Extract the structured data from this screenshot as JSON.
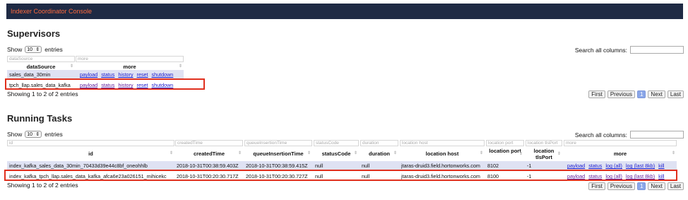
{
  "app": {
    "title": "Indexer Coordinator Console"
  },
  "supervisors": {
    "heading": "Supervisors",
    "show_label": "Show",
    "entries_value": "10",
    "entries_label": "entries",
    "search_label": "Search all columns:",
    "filters": [
      "dataSource",
      "more"
    ],
    "columns": [
      "dataSource",
      "more"
    ],
    "rows": [
      {
        "dataSource": "sales_data_30min",
        "links": [
          "payload",
          "status",
          "history",
          "reset",
          "shutdown"
        ]
      },
      {
        "dataSource": "tpch_llap.sales_data_kafka",
        "links": [
          "payload",
          "status",
          "history",
          "reset",
          "shutdown"
        ]
      }
    ],
    "info": "Showing 1 to 2 of 2 entries",
    "pager": {
      "first": "First",
      "previous": "Previous",
      "page": "1",
      "next": "Next",
      "last": "Last"
    }
  },
  "tasks": {
    "heading": "Running Tasks",
    "show_label": "Show",
    "entries_value": "10",
    "entries_label": "entries",
    "search_label": "Search all columns:",
    "filters": [
      "id",
      "createdTime",
      "queueInsertionTime",
      "statusCode",
      "duration",
      "location host",
      "location port",
      "location tlsPort",
      "more"
    ],
    "columns": [
      "id",
      "createdTime",
      "queueInsertionTime",
      "statusCode",
      "duration",
      "location host",
      "location port",
      "location tlsPort",
      "more"
    ],
    "rows": [
      {
        "id": "index_kafka_sales_data_30min_70433d39e44c8bf_oneohhlb",
        "createdTime": "2018-10-31T00:38:59.403Z",
        "queueInsertionTime": "2018-10-31T00:38:59.415Z",
        "statusCode": "null",
        "duration": "null",
        "host": "jtaras-druid3.field.hortonworks.com",
        "port": "8102",
        "tlsPort": "-1",
        "links": [
          "payload",
          "status",
          "log (all)",
          "log (last 8kb)",
          "kill"
        ]
      },
      {
        "id": "index_kafka_tpch_llap.sales_data_kafka_afca6e23a026151_mihicekc",
        "createdTime": "2018-10-31T00:20:30.717Z",
        "queueInsertionTime": "2018-10-31T00:20:30.727Z",
        "statusCode": "null",
        "duration": "null",
        "host": "jtaras-druid3.field.hortonworks.com",
        "port": "8100",
        "tlsPort": "-1",
        "links": [
          "payload",
          "status",
          "log (all)",
          "log (last 8kb)",
          "kill"
        ]
      }
    ],
    "info": "Showing 1 to 2 of 2 entries",
    "pager": {
      "first": "First",
      "previous": "Previous",
      "page": "1",
      "next": "Next",
      "last": "Last"
    }
  }
}
